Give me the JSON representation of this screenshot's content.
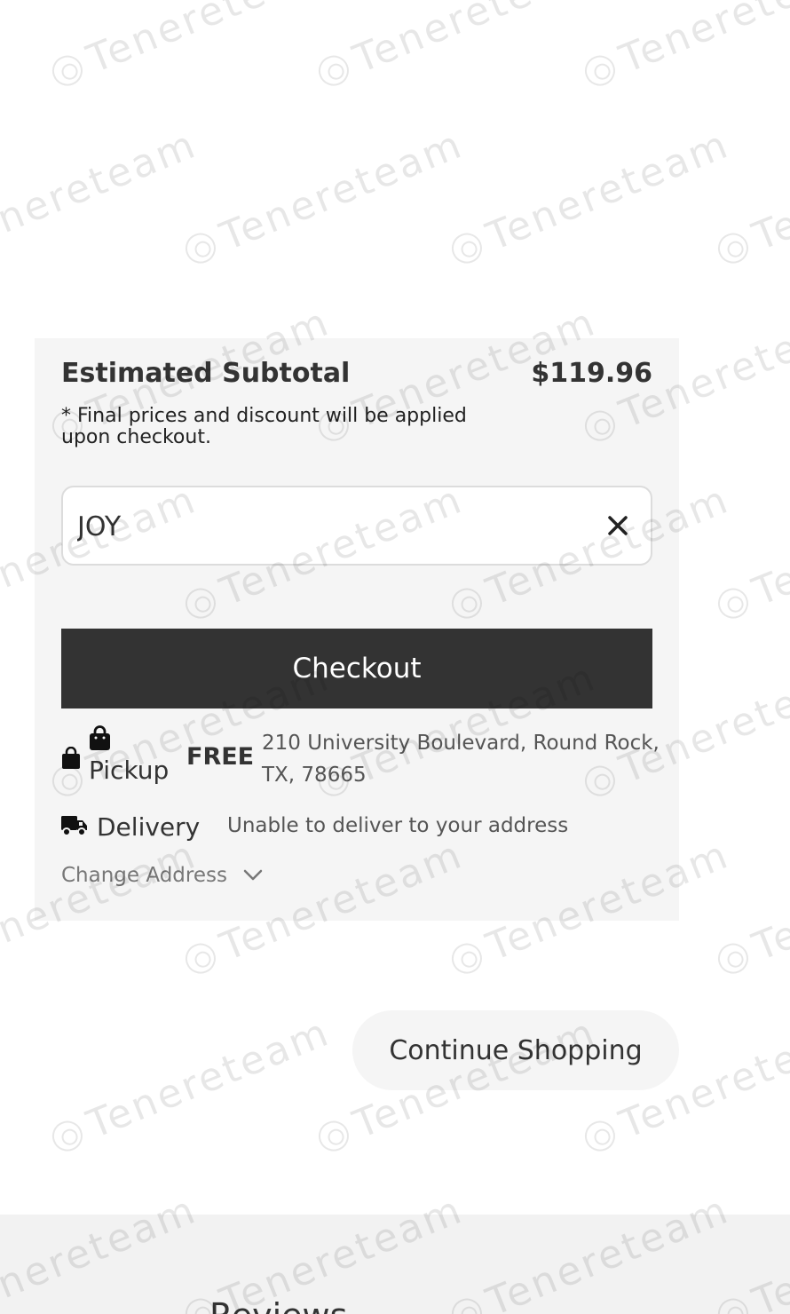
{
  "summary": {
    "subtotal_label": "Estimated Subtotal",
    "subtotal_amount": "$119.96",
    "note": "* Final prices and discount will be applied upon checkout."
  },
  "promo": {
    "value": "JOY",
    "clear_icon": "close-icon"
  },
  "checkout": {
    "label": "Checkout"
  },
  "fulfillment": {
    "pickup": {
      "icon": "shopping-bag-icon",
      "label": "Pickup",
      "price": "FREE",
      "address": "210 University Boulevard, Round Rock, TX, 78665"
    },
    "delivery": {
      "icon": "truck-icon",
      "label": "Delivery",
      "status": "Unable to deliver to your address"
    },
    "change_address_label": "Change Address"
  },
  "continue_shopping_label": "Continue Shopping",
  "reviews": {
    "heading": "Reviews"
  },
  "watermark": {
    "text": "Tenereteam"
  },
  "colors": {
    "panel_bg": "#f5f5f5",
    "checkout_bg": "#333333",
    "checkout_text": "#ffffff",
    "text_primary": "#333333",
    "text_secondary": "#555555",
    "text_muted": "#777777"
  }
}
